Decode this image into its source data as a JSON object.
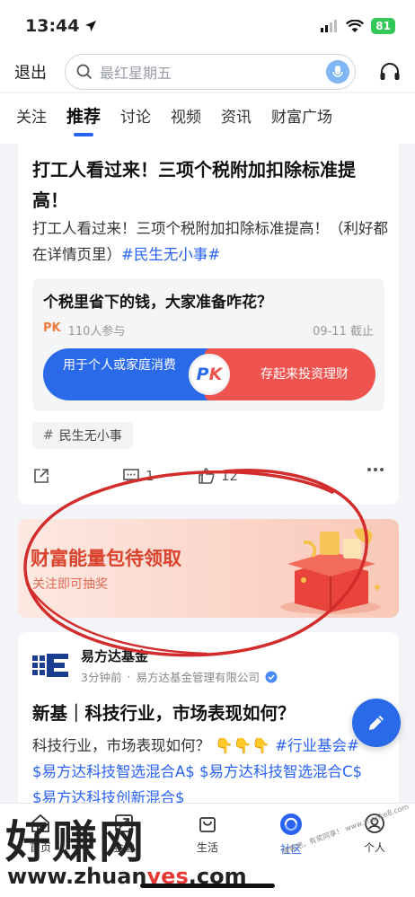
{
  "status_bar": {
    "time": "13:44",
    "battery": "81"
  },
  "header": {
    "back_label": "退出",
    "search_placeholder": "最红星期五"
  },
  "tabs": [
    {
      "label": "关注"
    },
    {
      "label": "推荐"
    },
    {
      "label": "讨论"
    },
    {
      "label": "视频"
    },
    {
      "label": "资讯"
    },
    {
      "label": "财富广场"
    }
  ],
  "post1": {
    "title": "打工人看过来！三项个税附加扣除标准提高！",
    "body": "打工人看过来！三项个税附加扣除标准提高！（利好都在详情页里）",
    "hashtag": "#民生无小事#",
    "pk": {
      "question": "个税里省下的钱，大家准备咋花？",
      "tag": "PK",
      "participants": "110人参与",
      "deadline": "09-11 截止",
      "option_left": "用于个人或家庭消费",
      "option_right": "存起来投资理财",
      "badge": "PK"
    },
    "topic_chip": "民生无小事",
    "comments": "1",
    "likes": "12"
  },
  "banner": {
    "title": "财富能量包待领取",
    "subtitle": "关注即可抽奖"
  },
  "post2": {
    "author": "易方达基金",
    "time": "3分钟前",
    "org": "易方达基金管理有限公司",
    "title": "新基｜科技行业，市场表现如何？",
    "body_text": "科技行业，市场表现如何？",
    "emoji": "👇👇👇",
    "tags": "#行业基会# $易方达科技智选混合A$ $易方达科技智选混合C$ $易方达科技创新混合$"
  },
  "bottom_nav": [
    {
      "label": "首页"
    },
    {
      "label": "金融"
    },
    {
      "label": "生活"
    },
    {
      "label": "社区"
    },
    {
      "label": "个人"
    }
  ],
  "watermark": {
    "text": "好赚网",
    "url_prefix": "www.zhuan",
    "url_red": "yes",
    "url_suffix": ".com",
    "small": "赚客吧，有奖同享！ www.zuanke8.com"
  },
  "colors": {
    "accent": "#2a63f2",
    "pk_blue": "#2a6ae8",
    "pk_red": "#ef5350",
    "banner_red": "#d9432d"
  }
}
